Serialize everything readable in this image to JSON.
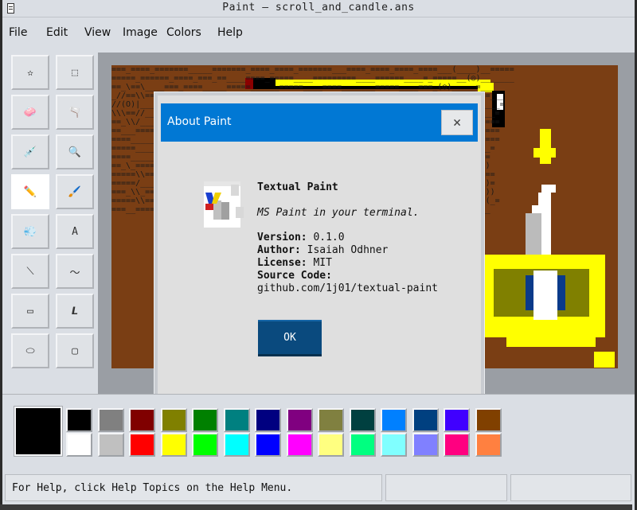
{
  "window": {
    "title": "Paint — scroll_and_candle.ans"
  },
  "menu": [
    "File",
    "Edit",
    "View",
    "Image",
    "Colors",
    "Help"
  ],
  "tools": [
    {
      "name": "free-form-select-tool",
      "glyph": "✫"
    },
    {
      "name": "rectangle-select-tool",
      "glyph": "⬚"
    },
    {
      "name": "eraser-tool",
      "glyph": "🧼"
    },
    {
      "name": "fill-bucket-tool",
      "glyph": "🫗"
    },
    {
      "name": "pick-color-tool",
      "glyph": "💉"
    },
    {
      "name": "magnifier-tool",
      "glyph": "🔍"
    },
    {
      "name": "pencil-tool",
      "glyph": "✏️"
    },
    {
      "name": "brush-tool",
      "glyph": "🖌️"
    },
    {
      "name": "airbrush-tool",
      "glyph": "💨"
    },
    {
      "name": "text-tool",
      "glyph": "A"
    },
    {
      "name": "line-tool",
      "glyph": "⟍"
    },
    {
      "name": "curve-tool",
      "glyph": "～"
    },
    {
      "name": "rectangle-tool",
      "glyph": "▭"
    },
    {
      "name": "polygon-tool",
      "glyph": "𝙇"
    },
    {
      "name": "ellipse-tool",
      "glyph": "⬭"
    },
    {
      "name": "rounded-rectangle-tool",
      "glyph": "▢"
    }
  ],
  "active_tool": "pencil-tool",
  "dialog": {
    "title": "About Paint",
    "close_glyph": "🗙",
    "app_name": "Textual Paint",
    "tagline": "MS Paint in your terminal.",
    "version_label": "Version:",
    "version": "0.1.0",
    "author_label": "Author:",
    "author": "Isaiah Odhner",
    "license_label": "License:",
    "license": "MIT",
    "source_label": "Source Code:",
    "source": "github.com/1j01/textual-paint",
    "ok_label": "OK"
  },
  "palette": {
    "current": "#000000",
    "top": [
      "#000000",
      "#808080",
      "#800000",
      "#808000",
      "#008000",
      "#008080",
      "#000080",
      "#800080",
      "#808040",
      "#004040",
      "#0080ff",
      "#004080",
      "#4000ff",
      "#804000"
    ],
    "bottom": [
      "#ffffff",
      "#c0c0c0",
      "#ff0000",
      "#ffff00",
      "#00ff00",
      "#00ffff",
      "#0000ff",
      "#ff00ff",
      "#ffff80",
      "#00ff80",
      "#80ffff",
      "#8080ff",
      "#ff0080",
      "#ff8040"
    ]
  },
  "status": {
    "help_text": "For Help, click Help Topics on the Help Menu."
  }
}
